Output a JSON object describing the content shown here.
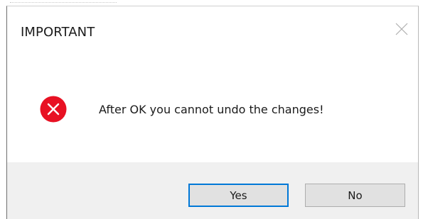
{
  "dialog": {
    "title": "IMPORTANT",
    "message": "After OK you cannot undo the changes!",
    "icon": "error-icon",
    "buttons": {
      "yes_label": "Yes",
      "no_label": "No"
    },
    "default_button": "Yes"
  },
  "colors": {
    "error_icon": "#e81123",
    "focus_border": "#0078d7",
    "footer_background": "#f0f0f0",
    "button_background": "#e1e1e1"
  }
}
